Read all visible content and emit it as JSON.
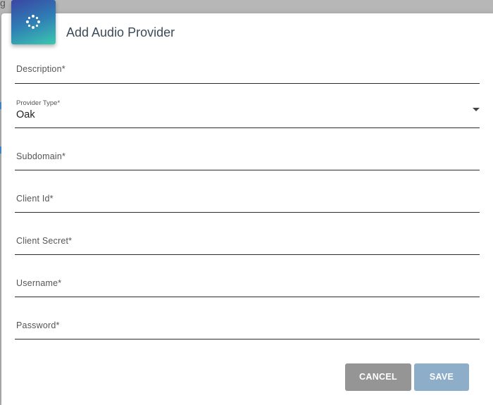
{
  "dialog": {
    "title": "Add Audio Provider",
    "icon": "provider-logo-icon"
  },
  "fields": {
    "description": {
      "label": "Description*",
      "value": ""
    },
    "provider_type": {
      "label": "Provider Type*",
      "value": "Oak"
    },
    "subdomain": {
      "label": "Subdomain*",
      "value": ""
    },
    "client_id": {
      "label": "Client Id*",
      "value": ""
    },
    "client_secret": {
      "label": "Client Secret*",
      "value": ""
    },
    "username": {
      "label": "Username*",
      "value": ""
    },
    "password": {
      "label": "Password*",
      "value": ""
    }
  },
  "actions": {
    "cancel_label": "CANCEL",
    "save_label": "SAVE"
  },
  "colors": {
    "header_gradient_start": "#3a45a3",
    "header_gradient_end": "#3cc8b0",
    "cancel_button": "#959595",
    "save_button_disabled": "#8eadc8"
  }
}
